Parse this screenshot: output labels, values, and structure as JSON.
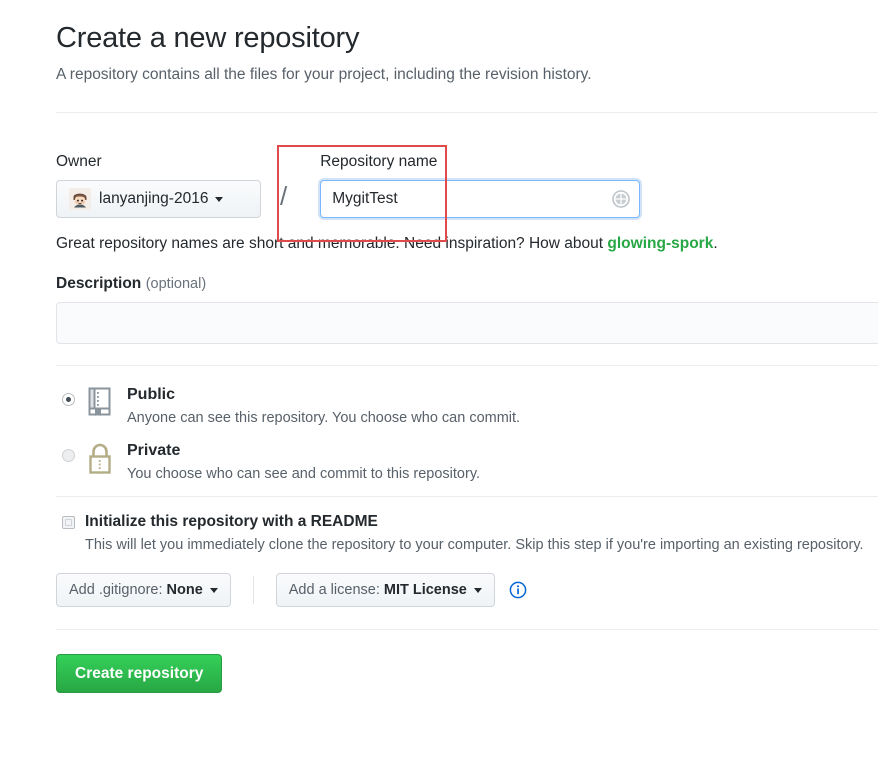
{
  "header": {
    "title": "Create a new repository",
    "subtitle": "A repository contains all the files for your project, including the revision history."
  },
  "owner": {
    "label": "Owner",
    "name": "lanyanjing-2016",
    "avatar_icon": "user-avatar-icon",
    "caret_icon": "chevron-down-icon",
    "separator": "/"
  },
  "repository_name": {
    "label": "Repository name",
    "value": "MygitTest",
    "placeholder": "",
    "status_icon": "globe-check-icon"
  },
  "hint": {
    "text_before": "Great repository names are short and memorable. Need inspiration? How about ",
    "link": "glowing-spork",
    "text_after": ".",
    "link_color": "#28a745"
  },
  "description": {
    "label": "Description",
    "optional": "(optional)",
    "value": "",
    "placeholder": ""
  },
  "visibility": {
    "options": [
      {
        "title": "Public",
        "description": "Anyone can see this repository. You choose who can commit.",
        "icon": "repo-book-icon",
        "selected": true,
        "icon_color": "#6a737d"
      },
      {
        "title": "Private",
        "description": "You choose who can see and commit to this repository.",
        "icon": "lock-icon",
        "selected": false,
        "icon_color": "#b3ae86"
      }
    ]
  },
  "readme": {
    "label": "Initialize this repository with a README",
    "description": "This will let you immediately clone the repository to your computer. Skip this step if you're importing an existing repository.",
    "checked": false
  },
  "gitignore": {
    "label": "Add .gitignore:",
    "value": "None",
    "caret_icon": "chevron-down-icon"
  },
  "license": {
    "label": "Add a license:",
    "value": "MIT License",
    "caret_icon": "chevron-down-icon",
    "info_icon": "info-circle-icon",
    "info_color": "#0366d6"
  },
  "submit": {
    "label": "Create repository",
    "color": "#28a745"
  },
  "annotation": {
    "shape": "rectangle",
    "color": "#e04a4a",
    "targets": "repository-name-field"
  }
}
